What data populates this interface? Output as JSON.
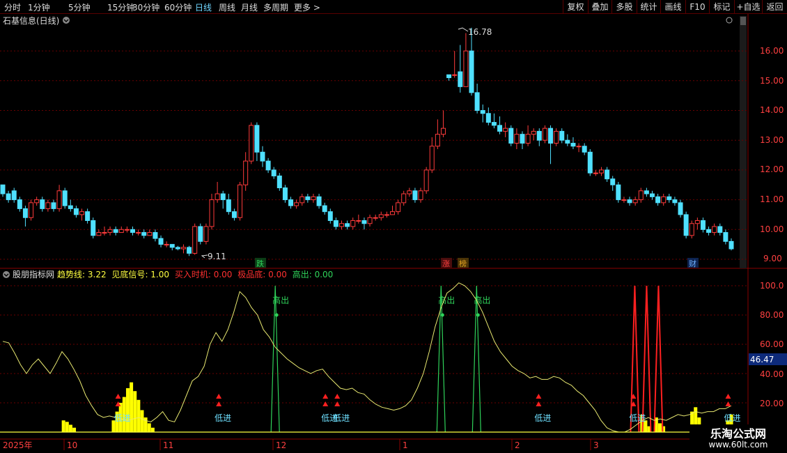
{
  "toolbar": {
    "periods": [
      "分时",
      "1分钟",
      "5分钟",
      "15分钟",
      "30分钟",
      "60分钟",
      "日线",
      "周线",
      "月线",
      "多周期",
      "更多"
    ],
    "active_period": "日线",
    "right_buttons": [
      "复权",
      "叠加",
      "多股",
      "统计",
      "画线",
      "F10",
      "标记",
      "+自选",
      "返回"
    ]
  },
  "main_chart": {
    "title": "石基信息(日线)",
    "high_label": "16.78",
    "low_label": "9.11",
    "y_ticks": [
      "16.00",
      "15.00",
      "14.00",
      "13.00",
      "12.00",
      "11.00",
      "10.00",
      "9.00"
    ],
    "event_labels": [
      {
        "text": "跌",
        "color": "#2fd35a"
      },
      {
        "text": "涨",
        "color": "#ff4040"
      },
      {
        "text": "榜",
        "color": "#e0a020"
      },
      {
        "text": "财",
        "color": "#6fb0ff"
      }
    ]
  },
  "indicator": {
    "name": "股朋指标网",
    "readouts": [
      {
        "label": "趋势线",
        "value": "3.22",
        "color": "#ffff40"
      },
      {
        "label": "见底信号",
        "value": "1.00",
        "color": "#ffff40"
      },
      {
        "label": "买入时机",
        "value": "0.00",
        "color": "#ff3030"
      },
      {
        "label": "极品底",
        "value": "0.00",
        "color": "#ff3030"
      },
      {
        "label": "高出",
        "value": "0.00",
        "color": "#2fd35a"
      }
    ],
    "y_ticks": [
      "100.0",
      "80.00",
      "60.00",
      "40.00",
      "20.00"
    ],
    "current_value": "46.47",
    "signal_low": "低进",
    "signal_high": "高出"
  },
  "date_axis": [
    "2025年",
    "10",
    "11",
    "12",
    "1",
    "2",
    "3"
  ],
  "watermark": {
    "line1": "乐淘公式网",
    "line2": "www.60lt.com"
  },
  "colors": {
    "up": "#ff3b3b",
    "down": "#4fe0ff",
    "trend": "#e8e870",
    "bars": "#ffff00",
    "green": "#2fd35a",
    "red": "#ff2020",
    "grid": "#6a0000"
  },
  "chart_data": {
    "type": "candlestick",
    "ylim": [
      8.9,
      17.0
    ],
    "candles": [
      [
        11.5,
        11.2,
        11.5,
        11.1
      ],
      [
        11.2,
        11.0,
        11.3,
        10.9
      ],
      [
        11.3,
        11.0,
        11.4,
        10.9
      ],
      [
        11.0,
        10.7,
        11.1,
        10.6
      ],
      [
        10.7,
        10.4,
        10.8,
        10.1
      ],
      [
        10.4,
        10.9,
        11.0,
        10.3
      ],
      [
        10.9,
        11.0,
        11.1,
        10.8
      ],
      [
        11.0,
        10.7,
        11.1,
        10.6
      ],
      [
        10.7,
        10.9,
        11.0,
        10.6
      ],
      [
        10.9,
        10.7,
        11.0,
        10.6
      ],
      [
        10.7,
        11.3,
        11.5,
        10.6
      ],
      [
        11.3,
        10.8,
        11.4,
        10.7
      ],
      [
        10.8,
        10.7,
        11.0,
        10.6
      ],
      [
        10.7,
        10.5,
        10.8,
        10.4
      ],
      [
        10.5,
        10.6,
        10.7,
        10.3
      ],
      [
        10.6,
        10.3,
        10.7,
        10.2
      ],
      [
        10.3,
        9.8,
        10.4,
        9.7
      ],
      [
        9.8,
        9.9,
        10.0,
        9.8
      ],
      [
        9.9,
        9.9,
        10.1,
        9.8
      ],
      [
        9.9,
        10.0,
        10.1,
        9.8
      ],
      [
        10.0,
        9.9,
        10.1,
        9.8
      ],
      [
        9.9,
        10.0,
        10.1,
        9.9
      ],
      [
        10.0,
        10.0,
        10.1,
        9.9
      ],
      [
        10.0,
        9.9,
        10.1,
        9.8
      ],
      [
        9.9,
        9.9,
        10.0,
        9.8
      ],
      [
        9.9,
        9.8,
        10.0,
        9.7
      ],
      [
        9.8,
        9.9,
        10.0,
        9.8
      ],
      [
        9.9,
        9.7,
        10.0,
        9.6
      ],
      [
        9.7,
        9.5,
        9.8,
        9.4
      ],
      [
        9.5,
        9.5,
        9.6,
        9.4
      ],
      [
        9.5,
        9.4,
        9.5,
        9.3
      ],
      [
        9.4,
        9.35,
        9.45,
        9.3
      ],
      [
        9.35,
        9.4,
        9.5,
        9.2
      ],
      [
        9.4,
        9.2,
        9.45,
        9.11
      ],
      [
        9.2,
        10.1,
        10.2,
        9.15
      ],
      [
        10.1,
        9.6,
        10.2,
        9.5
      ],
      [
        9.6,
        10.1,
        10.2,
        9.5
      ],
      [
        10.1,
        11.0,
        11.2,
        10.0
      ],
      [
        11.0,
        11.2,
        11.6,
        10.9
      ],
      [
        11.2,
        11.0,
        11.3,
        10.7
      ],
      [
        11.0,
        10.6,
        11.2,
        10.5
      ],
      [
        10.6,
        10.4,
        10.7,
        10.3
      ],
      [
        10.4,
        11.5,
        11.6,
        10.3
      ],
      [
        11.5,
        12.3,
        12.6,
        11.3
      ],
      [
        12.3,
        13.5,
        13.6,
        12.2
      ],
      [
        13.5,
        12.6,
        13.6,
        12.3
      ],
      [
        12.6,
        12.3,
        12.8,
        12.1
      ],
      [
        12.3,
        12.0,
        12.4,
        11.9
      ],
      [
        12.0,
        11.8,
        12.1,
        11.7
      ],
      [
        11.8,
        11.4,
        11.9,
        11.3
      ],
      [
        11.4,
        11.0,
        11.5,
        10.9
      ],
      [
        11.0,
        10.8,
        11.1,
        10.7
      ],
      [
        10.8,
        10.9,
        11.0,
        10.7
      ],
      [
        10.9,
        11.1,
        11.2,
        10.8
      ],
      [
        11.1,
        11.0,
        11.2,
        10.9
      ],
      [
        11.0,
        11.1,
        11.2,
        10.9
      ],
      [
        11.1,
        10.8,
        11.2,
        10.7
      ],
      [
        10.8,
        10.6,
        10.9,
        10.5
      ],
      [
        10.6,
        10.3,
        10.7,
        10.2
      ],
      [
        10.3,
        10.1,
        10.4,
        10.0
      ],
      [
        10.1,
        10.2,
        10.3,
        10.0
      ],
      [
        10.2,
        10.1,
        10.3,
        10.0
      ],
      [
        10.1,
        10.3,
        10.4,
        10.0
      ],
      [
        10.3,
        10.3,
        10.5,
        10.2
      ],
      [
        10.3,
        10.2,
        10.4,
        10.0
      ],
      [
        10.2,
        10.4,
        10.5,
        10.1
      ],
      [
        10.4,
        10.4,
        10.5,
        10.3
      ],
      [
        10.4,
        10.5,
        10.6,
        10.3
      ],
      [
        10.5,
        10.5,
        10.6,
        10.4
      ],
      [
        10.5,
        10.6,
        10.8,
        10.5
      ],
      [
        10.6,
        10.9,
        11.0,
        10.5
      ],
      [
        10.9,
        11.2,
        11.3,
        10.8
      ],
      [
        11.2,
        11.3,
        11.4,
        11.1
      ],
      [
        11.3,
        11.0,
        11.4,
        10.9
      ],
      [
        11.0,
        11.3,
        11.4,
        10.9
      ],
      [
        11.3,
        12.0,
        12.1,
        11.2
      ],
      [
        12.0,
        12.8,
        13.1,
        11.9
      ],
      [
        12.8,
        13.2,
        13.7,
        12.7
      ],
      [
        13.2,
        13.4,
        14.0,
        13.1
      ],
      [
        15.2,
        15.1,
        15.2,
        15.0
      ],
      [
        15.2,
        15.2,
        16.0,
        15.1
      ],
      [
        15.3,
        14.8,
        16.2,
        14.6
      ],
      [
        14.8,
        16.0,
        16.6,
        14.8
      ],
      [
        16.0,
        14.6,
        16.78,
        14.5
      ],
      [
        14.6,
        14.0,
        14.9,
        13.9
      ],
      [
        14.0,
        13.9,
        14.2,
        13.6
      ],
      [
        13.9,
        13.6,
        14.1,
        13.5
      ],
      [
        13.6,
        13.5,
        13.9,
        13.4
      ],
      [
        13.5,
        13.3,
        13.8,
        13.2
      ],
      [
        13.3,
        13.4,
        13.6,
        13.1
      ],
      [
        13.4,
        12.9,
        13.5,
        12.8
      ],
      [
        12.9,
        13.2,
        13.4,
        12.7
      ],
      [
        13.2,
        12.9,
        13.3,
        12.7
      ],
      [
        12.9,
        13.2,
        13.5,
        12.8
      ],
      [
        13.2,
        13.3,
        13.4,
        13.0
      ],
      [
        13.3,
        13.0,
        13.4,
        12.8
      ],
      [
        13.0,
        13.4,
        13.5,
        12.9
      ],
      [
        13.4,
        12.9,
        13.5,
        12.2
      ],
      [
        12.9,
        13.3,
        13.4,
        12.8
      ],
      [
        13.3,
        13.0,
        13.4,
        12.9
      ],
      [
        13.0,
        12.9,
        13.2,
        12.8
      ],
      [
        12.9,
        12.8,
        13.1,
        12.7
      ],
      [
        12.8,
        12.8,
        12.9,
        12.6
      ],
      [
        12.8,
        12.6,
        12.9,
        12.5
      ],
      [
        12.6,
        11.9,
        12.7,
        11.8
      ],
      [
        11.9,
        11.9,
        12.0,
        11.8
      ],
      [
        11.9,
        12.0,
        12.1,
        11.8
      ],
      [
        12.0,
        11.7,
        12.1,
        11.6
      ],
      [
        11.7,
        11.5,
        11.8,
        11.3
      ],
      [
        11.5,
        11.0,
        11.6,
        10.9
      ],
      [
        11.0,
        11.0,
        11.1,
        10.9
      ],
      [
        11.0,
        10.9,
        11.1,
        10.8
      ],
      [
        10.9,
        11.0,
        11.1,
        10.8
      ],
      [
        11.0,
        11.3,
        11.4,
        10.9
      ],
      [
        11.3,
        11.2,
        11.4,
        11.1
      ],
      [
        11.2,
        11.1,
        11.3,
        11.0
      ],
      [
        11.1,
        10.9,
        11.2,
        10.8
      ],
      [
        10.9,
        11.1,
        11.2,
        10.8
      ],
      [
        11.1,
        11.0,
        11.2,
        10.9
      ],
      [
        11.0,
        10.9,
        11.1,
        10.8
      ],
      [
        10.9,
        10.5,
        11.0,
        10.4
      ],
      [
        10.5,
        9.8,
        10.6,
        9.7
      ],
      [
        9.8,
        10.2,
        10.3,
        9.7
      ],
      [
        10.2,
        10.3,
        10.4,
        10.0
      ],
      [
        10.3,
        10.0,
        10.4,
        9.9
      ],
      [
        10.0,
        9.9,
        10.1,
        9.8
      ],
      [
        9.9,
        10.1,
        10.2,
        9.8
      ],
      [
        10.1,
        9.9,
        10.2,
        9.8
      ],
      [
        9.9,
        9.6,
        10.0,
        9.5
      ],
      [
        9.6,
        9.35,
        9.7,
        9.3
      ]
    ],
    "indicator_trend": [
      62,
      61,
      54,
      46,
      40,
      46,
      50,
      45,
      40,
      47,
      55,
      50,
      43,
      35,
      25,
      18,
      12,
      10,
      11,
      10,
      9,
      8,
      9,
      10,
      8,
      7,
      10,
      14,
      8,
      7,
      15,
      25,
      35,
      38,
      45,
      60,
      68,
      62,
      70,
      82,
      96,
      92,
      85,
      80,
      70,
      65,
      58,
      54,
      50,
      47,
      44,
      42,
      40,
      42,
      43,
      38,
      34,
      30,
      29,
      30,
      27,
      26,
      22,
      19,
      17,
      16,
      15,
      16,
      18,
      22,
      30,
      40,
      55,
      72,
      85,
      95,
      98,
      102,
      100,
      96,
      90,
      82,
      72,
      62,
      55,
      50,
      45,
      42,
      40,
      37,
      38,
      36,
      36,
      38,
      37,
      34,
      32,
      28,
      25,
      20,
      15,
      8,
      3,
      1,
      0,
      0,
      2,
      5,
      8,
      10,
      8,
      9,
      8,
      10,
      12,
      11,
      12,
      14,
      13,
      14,
      14,
      16,
      16,
      18
    ],
    "indicator_bars": [
      0,
      0,
      0,
      0,
      0,
      0,
      0,
      0,
      0,
      0,
      0,
      0,
      0,
      0,
      0,
      0,
      0,
      8,
      7,
      5,
      3,
      0,
      0,
      0,
      0,
      0,
      0,
      0,
      0,
      0,
      0,
      8,
      14,
      20,
      24,
      30,
      34,
      28,
      22,
      15,
      10,
      6,
      3,
      0,
      0,
      0,
      0,
      0,
      0,
      0,
      0,
      0,
      0,
      0,
      0,
      0,
      0,
      0,
      0,
      0,
      0,
      0,
      0,
      0,
      0,
      0,
      0,
      0,
      0,
      0,
      0,
      0,
      0,
      0,
      0,
      0,
      0,
      0,
      0,
      0,
      0,
      0,
      0,
      0,
      0,
      0,
      0,
      0,
      0,
      0,
      0,
      0,
      0,
      0,
      0,
      0,
      0,
      0,
      0,
      0,
      0,
      0,
      0,
      0,
      0,
      0,
      0,
      0,
      0,
      0,
      0,
      0,
      0,
      0,
      0,
      0,
      0,
      0,
      0,
      0,
      0,
      0,
      0,
      0,
      0,
      0,
      0,
      0,
      0,
      0,
      0,
      0,
      0,
      0,
      0,
      0,
      0,
      0,
      0,
      0,
      0,
      0,
      0,
      0,
      0,
      0,
      0,
      0,
      0,
      0,
      0,
      0,
      0,
      0,
      0,
      0,
      0,
      0,
      0,
      0,
      0,
      0,
      0,
      0,
      0,
      0,
      0,
      0,
      0,
      0,
      0,
      0,
      0,
      0,
      0,
      0,
      0,
      0,
      0,
      12,
      8,
      4,
      0,
      10,
      6,
      4,
      0,
      0,
      0,
      0,
      0,
      0,
      0,
      14,
      17,
      10,
      0,
      0,
      0,
      0,
      3,
      0,
      0,
      8,
      12
    ],
    "green_spikes_x": [
      46,
      74,
      80
    ],
    "red_spikes_x": [
      106,
      108,
      110
    ],
    "low_signals_x": [
      19,
      36,
      54,
      56,
      90,
      106,
      122
    ],
    "high_signals_x": [
      46,
      74,
      80
    ]
  }
}
